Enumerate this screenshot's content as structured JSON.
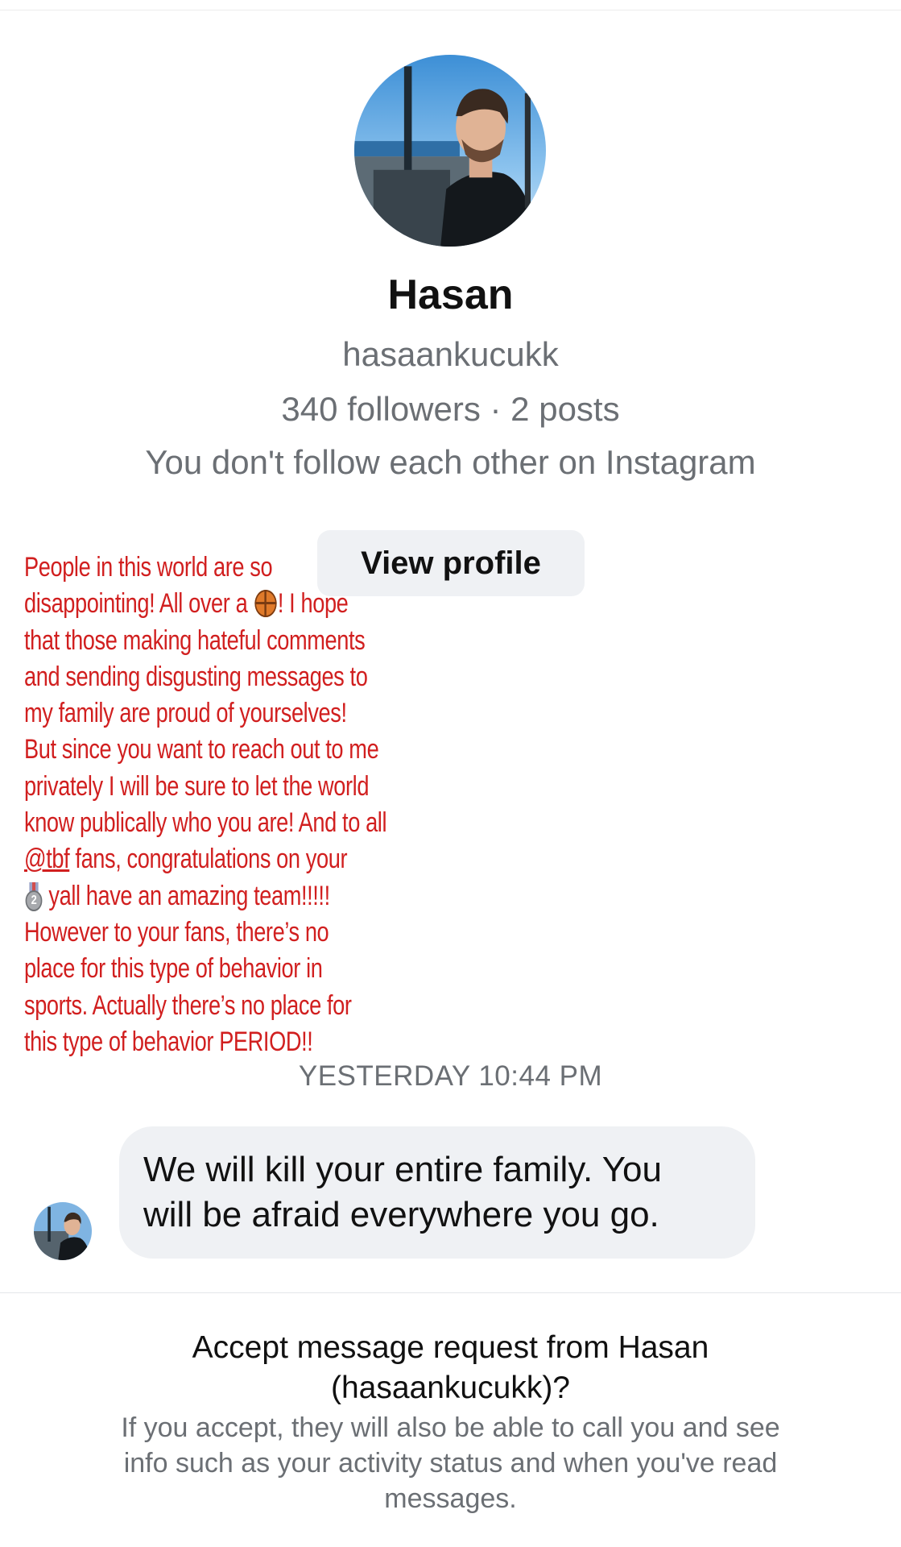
{
  "profile": {
    "name": "Hasan",
    "handle": "hasaankucukk",
    "stats": "340 followers · 2 posts",
    "follow_note": "You don't follow each other on Instagram",
    "view_profile_label": "View profile",
    "avatar_icon": "profile-photo"
  },
  "statement": {
    "color": "#d11f1f",
    "line1": "People in this world are so",
    "line2_a": "disappointing! All over a ",
    "line2_b": "! I hope",
    "line3": "that those making hateful comments",
    "line4": "and sending disgusting messages to",
    "line5": "my family are proud of yourselves!",
    "line6": "But since you want to reach out to me",
    "line7": "privately I will be sure to let the world",
    "line8": "know publically who you are! And to all",
    "mention": "@tbf",
    "line9_rest": " fans, congratulations on your",
    "line10": "yall have an amazing team!!!!!",
    "line11": "However to your fans, there’s no",
    "line12": "place for this type of behavior in",
    "line13": "sports. Actually there’s no place for",
    "line14": "this type of behavior PERIOD!!",
    "basketball_icon": "basketball-emoji",
    "medal_icon": "second-place-medal-emoji",
    "medal_number": "2"
  },
  "conversation": {
    "timestamp": "YESTERDAY 10:44 PM",
    "message_line1": "We will kill your entire family. You",
    "message_line2": "will be afraid everywhere you go."
  },
  "request": {
    "title_line1": "Accept message request from Hasan",
    "title_line2": "(hasaankucukk)?",
    "body_line1": "If you accept, they will also be able to call you and see",
    "body_line2": "info such as your activity status and when you've read",
    "body_line3": "messages."
  }
}
